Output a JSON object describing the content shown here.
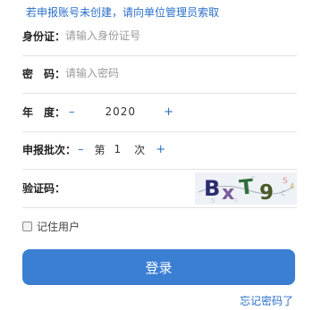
{
  "notice": "若申报账号未创建，请向单位管理员索取",
  "id_field": {
    "label": "身份证：",
    "placeholder": "请输入身份证号",
    "value": ""
  },
  "password_field": {
    "label": "密　码：",
    "placeholder": "请输入密码",
    "value": ""
  },
  "year_field": {
    "label": "年　度：",
    "minus": "–",
    "value": "2020",
    "plus": "+"
  },
  "batch_field": {
    "label": "申报批次：",
    "minus": "–",
    "prefix": "第",
    "value": "1",
    "suffix": "次",
    "plus": "+"
  },
  "captcha_field": {
    "label": "验证码：",
    "value": "",
    "image_text": "BxT9"
  },
  "remember_label": "记住用户",
  "remember_checked": false,
  "login_button": "登录",
  "forgot_link": "忘记密码了",
  "colors": {
    "accent": "#3b7fd3",
    "link": "#2a6fc9",
    "divider": "#e3e3e3"
  }
}
